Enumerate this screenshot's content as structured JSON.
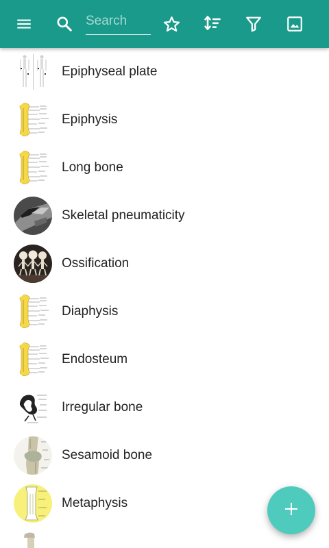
{
  "toolbar": {
    "background": "#1a9a8b",
    "icons": [
      "menu-icon",
      "search-icon",
      "star-outline-icon",
      "sort-icon",
      "filter-icon",
      "image-icon"
    ],
    "search": {
      "placeholder": "Search",
      "value": ""
    }
  },
  "list": {
    "items": [
      {
        "label": "Epiphyseal plate",
        "thumbnail": "skeleton-xray"
      },
      {
        "label": "Epiphysis",
        "thumbnail": "long-bone-diagram"
      },
      {
        "label": "Long bone",
        "thumbnail": "long-bone-diagram"
      },
      {
        "label": "Skeletal pneumaticity",
        "thumbnail": "bone-photo-dark"
      },
      {
        "label": "Ossification",
        "thumbnail": "fetal-skeletons-photo"
      },
      {
        "label": "Diaphysis",
        "thumbnail": "long-bone-diagram"
      },
      {
        "label": "Endosteum",
        "thumbnail": "long-bone-diagram"
      },
      {
        "label": "Irregular bone",
        "thumbnail": "vertebra-sketch"
      },
      {
        "label": "Sesamoid bone",
        "thumbnail": "knee-joint-illustration"
      },
      {
        "label": "Metaphysis",
        "thumbnail": "bone-diagram-yellow"
      },
      {
        "label": "",
        "thumbnail": "partial-bone"
      }
    ]
  },
  "fab": {
    "icon": "plus-icon",
    "color": "#4fcbbd"
  }
}
